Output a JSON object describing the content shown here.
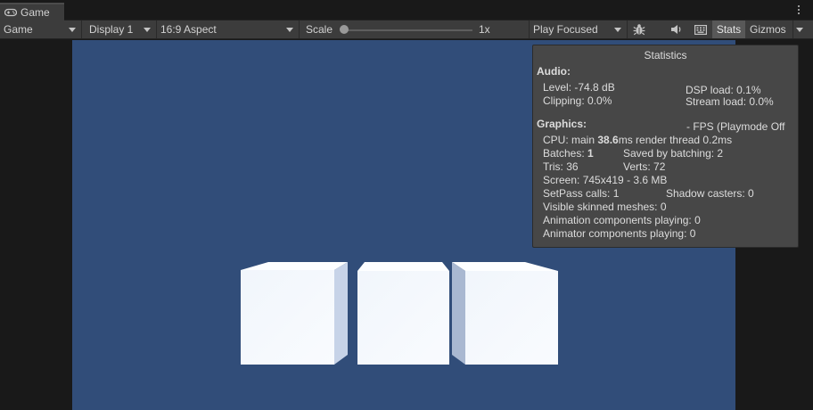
{
  "tab": {
    "label": "Game",
    "icon": "gamepad-icon"
  },
  "toolbar": {
    "view_mode": "Game",
    "display": "Display 1",
    "aspect": "16:9 Aspect",
    "scale_label": "Scale",
    "scale_value": "1x",
    "play_mode": "Play Focused",
    "stats_label": "Stats",
    "gizmos_label": "Gizmos"
  },
  "scene": {
    "background_color": "#314d79",
    "cube_color": "#f4f8fd"
  },
  "stats": {
    "title": "Statistics",
    "audio_heading": "Audio:",
    "level": "Level: -74.8 dB",
    "clipping": "Clipping: 0.0%",
    "dsp_load": "DSP load: 0.1%",
    "stream_load": "Stream load: 0.0%",
    "graphics_heading": "Graphics:",
    "fps": "- FPS (Playmode Off",
    "cpu_prefix": "CPU: main ",
    "cpu_main": "38.6",
    "cpu_suffix": "ms  render thread 0.2ms",
    "batches_prefix": "Batches: ",
    "batches_value": "1",
    "saved_by_batching": "Saved by batching: 2",
    "tris": "Tris: 36",
    "verts": "Verts: 72",
    "screen": "Screen: 745x419 - 3.6 MB",
    "setpass": "SetPass calls: 1",
    "shadow_casters": "Shadow casters: 0",
    "skinned": "Visible skinned meshes: 0",
    "anim_components": "Animation components playing: 0",
    "animator_components": "Animator components playing: 0"
  }
}
